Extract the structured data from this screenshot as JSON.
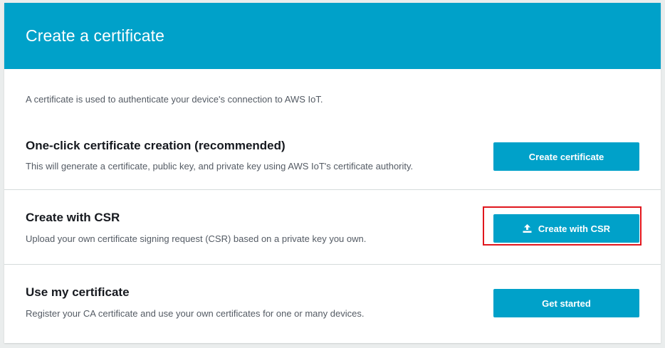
{
  "header": {
    "title": "Create a certificate"
  },
  "intro": {
    "text": "A certificate is used to authenticate your device's connection to AWS IoT."
  },
  "options": [
    {
      "title": "One-click certificate creation (recommended)",
      "description": "This will generate a certificate, public key, and private key using AWS IoT's certificate authority.",
      "button_label": "Create certificate"
    },
    {
      "title": "Create with CSR",
      "description": "Upload your own certificate signing request (CSR) based on a private key you own.",
      "button_label": "Create with CSR",
      "button_icon": "upload-icon"
    },
    {
      "title": "Use my certificate",
      "description": "Register your CA certificate and use your own certificates for one or many devices.",
      "button_label": "Get started"
    }
  ],
  "colors": {
    "accent": "#00a1c9",
    "highlight": "#e0161d"
  }
}
